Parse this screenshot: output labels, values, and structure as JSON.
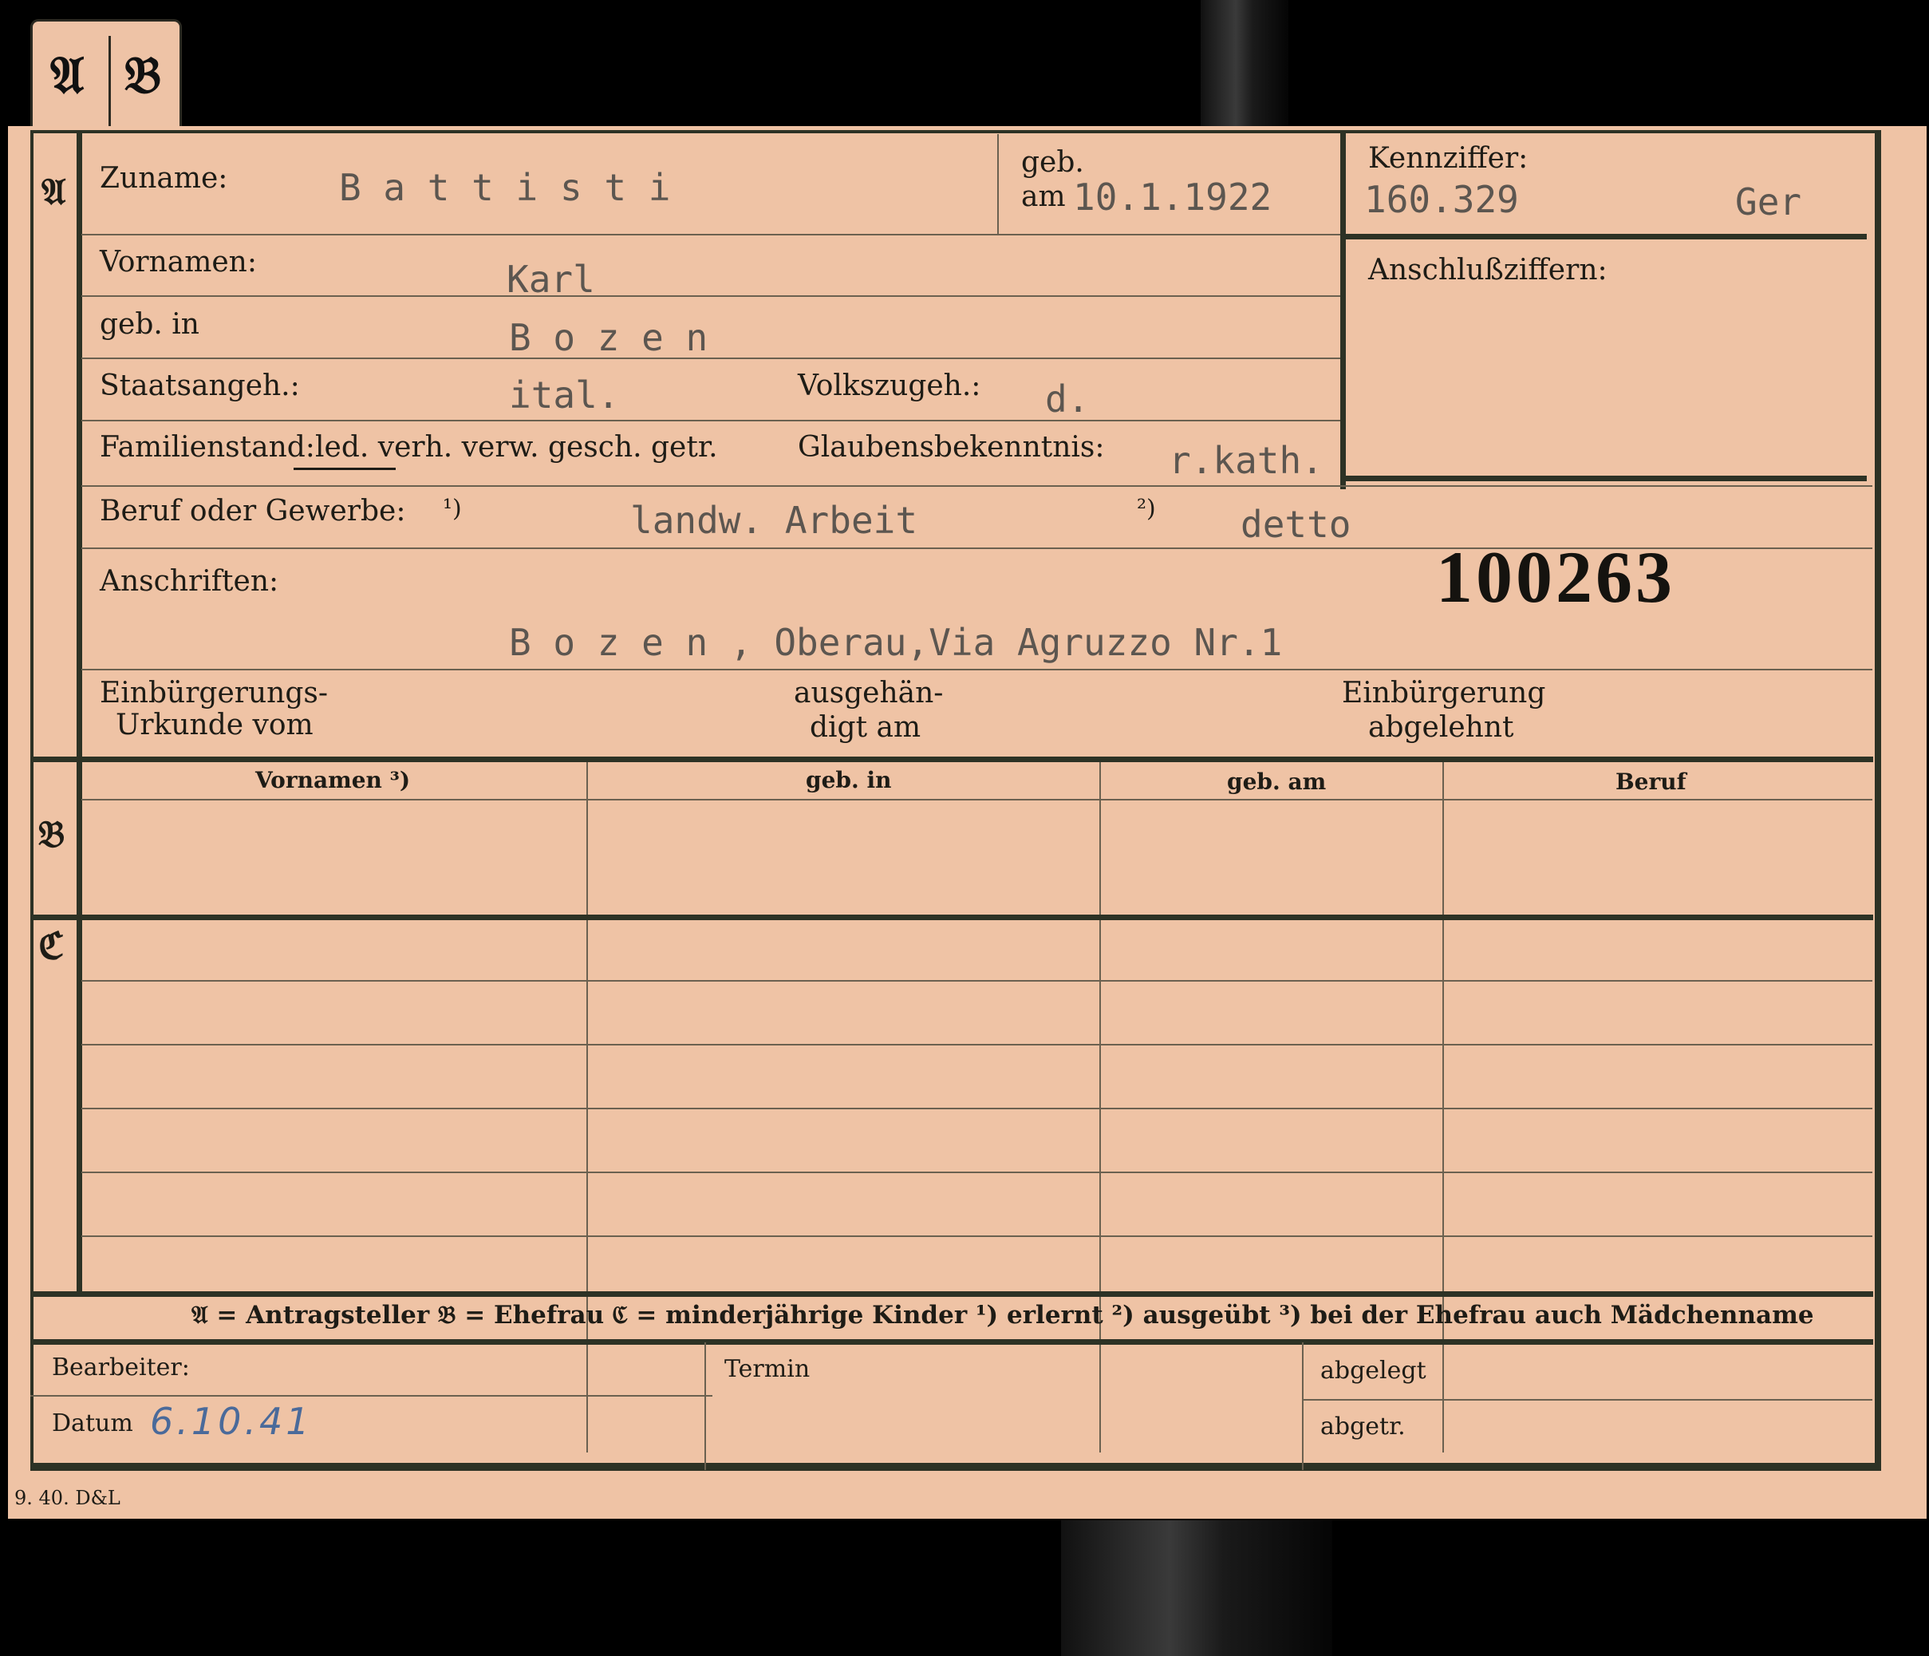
{
  "tab": {
    "a": "𝔄",
    "b": "𝔅"
  },
  "sections": {
    "a": "𝔄",
    "b": "𝔅",
    "c": "ℭ"
  },
  "fields": {
    "zuname_label": "Zuname:",
    "zuname_value": "B a t t i s t i",
    "geb_label_top": "geb.",
    "geb_label_am": "am",
    "geb_value": "10.1.1922",
    "kennziffer_label": "Kennziffer:",
    "kennziffer_value": "160.329",
    "kennziffer_suffix": "Ger",
    "anschluss_label": "Anschlußziffern:",
    "vornamen_label": "Vornamen:",
    "vornamen_value": "Karl",
    "gebin_label": "geb. in",
    "gebin_value": "B o z e n",
    "staat_label": "Staatsangeh.:",
    "staat_value": "ital.",
    "volk_label": "Volkszugeh.:",
    "volk_value": "d.",
    "familienstand_label": "Familienstand:",
    "familienstand_options": "led. verh. verw. gesch. getr.",
    "glauben_label": "Glaubensbekenntnis:",
    "glauben_value": "r.kath.",
    "beruf_label": "Beruf oder Gewerbe:",
    "beruf_note1": "¹)",
    "beruf_value1": "landw. Arbeit",
    "beruf_note2": "²)",
    "beruf_value2": "detto",
    "anschriften_label": "Anschriften:",
    "stamp_number": "100263",
    "anschrift_value": "B o z e n , Oberau,Via Agruzzo Nr.1",
    "einb_urkunde_1": "Einbürgerungs-",
    "einb_urkunde_2": "Urkunde vom",
    "ausgehaendigt_1": "ausgehän-",
    "ausgehaendigt_2": "digt am",
    "einb_abgelehnt_1": "Einbürgerung",
    "einb_abgelehnt_2": "abgelehnt"
  },
  "table_headers": [
    "Vornamen ³)",
    "geb. in",
    "geb. am",
    "Beruf"
  ],
  "legend": "𝔄 = Antragsteller   𝔅 = Ehefrau   ℭ = minderjährige Kinder   ¹) erlernt   ²) ausgeübt   ³) bei der Ehefrau auch Mädchenname",
  "footer": {
    "bearbeiter_label": "Bearbeiter:",
    "datum_label": "Datum",
    "datum_value": "6.10.41",
    "termin_label": "Termin",
    "abgelegt_label": "abgelegt",
    "abgetr_label": "abgetr."
  },
  "printer_mark": "9. 40. D&L"
}
